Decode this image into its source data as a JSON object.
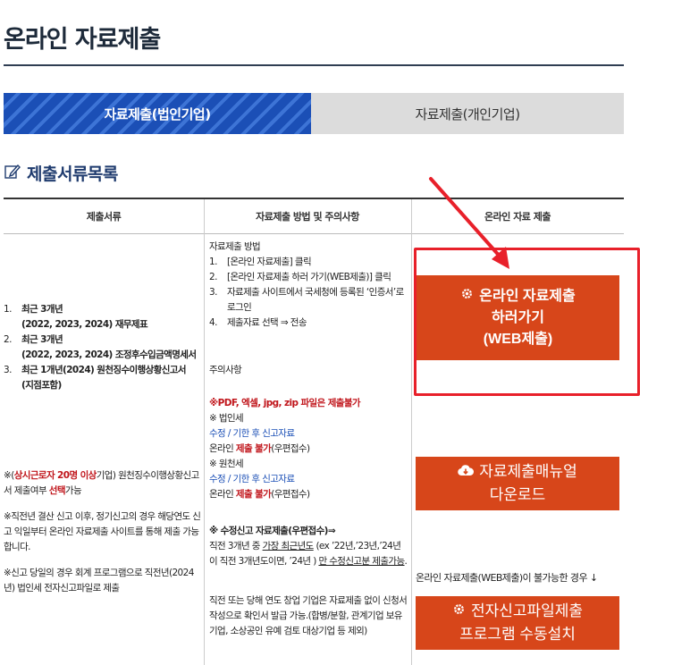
{
  "page": {
    "title": "온라인 자료제출"
  },
  "tabs": [
    {
      "label": "자료제출(법인기업)",
      "active": true
    },
    {
      "label": "자료제출(개인기업)",
      "active": false
    }
  ],
  "section": {
    "title": "제출서류목록",
    "icon": "pencil-icon"
  },
  "table": {
    "headers": [
      "제출서류",
      "자료제출 방법 및 주의사항",
      "온라인 자료 제출"
    ],
    "documents": [
      {
        "num": "1.",
        "title": "최근 3개년",
        "sub": "(2022, 2023, 2024) 재무제표"
      },
      {
        "num": "2.",
        "title": "최근 3개년",
        "sub": "(2022, 2023, 2024) 조정후수입금액명세서"
      },
      {
        "num": "3.",
        "title": "최근 1개년(2024) 원천징수이행상황신고서",
        "sub": "(지점포함)"
      }
    ],
    "doc_notes": {
      "n1_pre": "※(",
      "n1_red": "상시근로자 20명 이상",
      "n1_mid": "기업) 원천징수이행상황신고서 제출여부 ",
      "n1_red2": "선택",
      "n1_post": "가능",
      "n2": "※직전년 결산 신고 이후, 정기신고의 경우 해당연도 신고 익일부터 온라인 자료제출 사이트를 통해 제출 가능합니다.",
      "n3": "※신고 당일의 경우 회계 프로그램으로 직전년(2024년) 법인세 전자신고파일로 제출"
    },
    "method": {
      "heading": "자료제출 방법",
      "steps": [
        {
          "num": "1.",
          "text": "[온라인 자료제출] 클릭"
        },
        {
          "num": "2.",
          "text": "[온라인 자료제출 하러 가기(WEB제출)] 클릭"
        },
        {
          "num": "3.",
          "text": "자료제출 사이트에서 국세청에 등록된 ‘인증서’로 로그인"
        },
        {
          "num": "4.",
          "text": "제출자료 선택 ⇒ 전송"
        }
      ],
      "caution_heading": "주의사항",
      "no_files": "※PDF, 엑셀, jpg, zip 파일은 제출불가",
      "corp_tax": "※ 법인세",
      "amend": "수정 / 기한 후 신고자료",
      "online_pre": "온라인 ",
      "online_red": "제출 불가",
      "online_post": "(우편접수)",
      "withholding": "※ 원천세",
      "amend2": "수정 / 기한 후 신고자료",
      "online2_pre": "온라인 ",
      "online2_red": "제출 불가",
      "online2_post": "(우편접수)",
      "amend_submit": "※ 수정신고 자료제출(우편접수)⇒",
      "amend_desc_a": "직전 3개년 중 ",
      "amend_desc_u1": "가장 최근년도",
      "amend_desc_b": " (ex ’22년,’23년,’24년이 직전 3개년도이면, ’24년 ) ",
      "amend_desc_u2": "만 수정신고분 제출가능",
      "amend_desc_c": ".",
      "startup_note": "직전 또는 당해 연도 창업 기업은 자료제출 없이 신청서 작성으로 확인서 발급 가능.(합병/분할, 관계기업 보유기업, 소상공인 유예 검토 대상기업 등 제외)"
    },
    "online": {
      "web_button": [
        "온라인 자료제출",
        "하러가기",
        "(WEB제출)"
      ],
      "web_icon": "gear-icon",
      "manual_button": [
        "자료제출매뉴얼",
        "다운로드"
      ],
      "manual_icon": "cloud-download-icon",
      "web_unavailable_note": "온라인 자료제출(WEB제출)이 불가능한 경우 ↓",
      "install_button": [
        "전자신고파일제출",
        "프로그램 수동설치"
      ],
      "install_icon": "gear-icon"
    }
  },
  "colors": {
    "tab_active": "#1b4fb6",
    "tab_inactive": "#dcdcdc",
    "button": "#d7461a",
    "highlight_box": "#e8202a",
    "red_text": "#c0151b",
    "blue_text": "#1b4fb6",
    "title": "#1d2a3a"
  }
}
